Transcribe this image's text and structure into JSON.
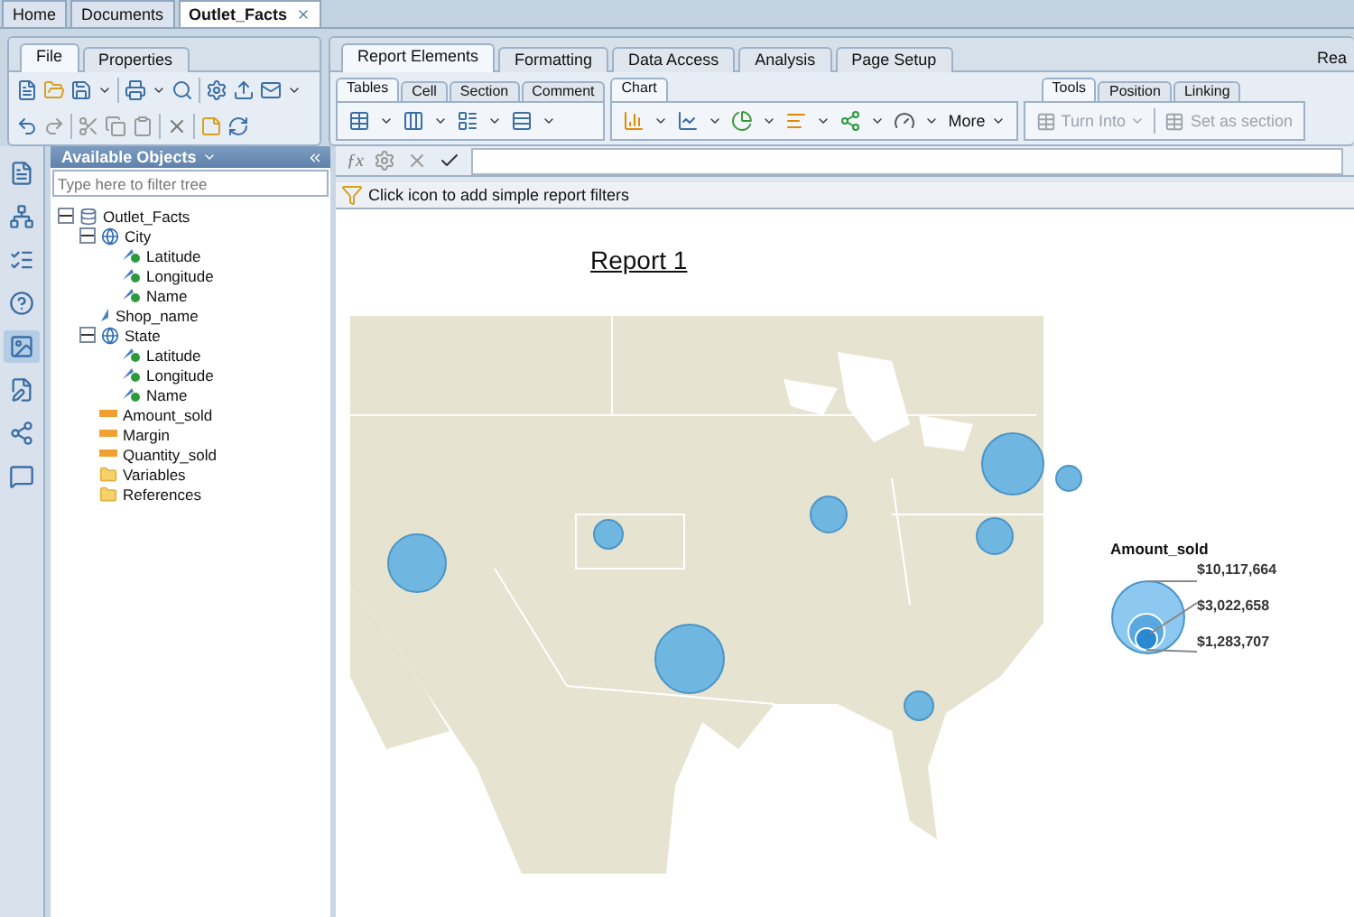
{
  "top_tabs": [
    {
      "label": "Home",
      "selected": false
    },
    {
      "label": "Documents",
      "selected": false
    },
    {
      "label": "Outlet_Facts",
      "selected": true
    }
  ],
  "left_ribbon": {
    "tabs": [
      {
        "label": "File",
        "selected": true
      },
      {
        "label": "Properties",
        "selected": false
      }
    ]
  },
  "main_ribbon": {
    "tabs": [
      {
        "label": "Report Elements",
        "selected": true
      },
      {
        "label": "Formatting",
        "selected": false
      },
      {
        "label": "Data Access",
        "selected": false
      },
      {
        "label": "Analysis",
        "selected": false
      },
      {
        "label": "Page Setup",
        "selected": false
      }
    ],
    "cut_label": "Rea",
    "table_tabs": [
      {
        "label": "Tables",
        "selected": true
      },
      {
        "label": "Cell",
        "selected": false
      },
      {
        "label": "Section",
        "selected": false
      },
      {
        "label": "Comment",
        "selected": false
      }
    ],
    "chart_tabs": [
      {
        "label": "Chart",
        "selected": true
      }
    ],
    "more_button": "More",
    "tool_tabs": [
      {
        "label": "Tools",
        "selected": true
      },
      {
        "label": "Position",
        "selected": false
      },
      {
        "label": "Linking",
        "selected": false
      }
    ],
    "tool_buttons": [
      {
        "label": "Turn Into",
        "disabled": true,
        "dropdown": true
      },
      {
        "label": "Set as section",
        "disabled": true,
        "dropdown": false
      }
    ]
  },
  "side_panel": {
    "title": "Available Objects",
    "filter": {
      "placeholder": "Type here to filter tree"
    },
    "tree": [
      {
        "label": "Outlet_Facts",
        "kind": "universe",
        "expanded": true,
        "children": [
          {
            "label": "City",
            "kind": "geo",
            "expanded": true,
            "children": [
              {
                "label": "Latitude",
                "kind": "attribute"
              },
              {
                "label": "Longitude",
                "kind": "attribute"
              },
              {
                "label": "Name",
                "kind": "attribute"
              }
            ]
          },
          {
            "label": "Shop_name",
            "kind": "dimension"
          },
          {
            "label": "State",
            "kind": "geo",
            "expanded": true,
            "children": [
              {
                "label": "Latitude",
                "kind": "attribute"
              },
              {
                "label": "Longitude",
                "kind": "attribute"
              },
              {
                "label": "Name",
                "kind": "attribute"
              }
            ]
          },
          {
            "label": "Amount_sold",
            "kind": "measure"
          },
          {
            "label": "Margin",
            "kind": "measure"
          },
          {
            "label": "Quantity_sold",
            "kind": "measure"
          },
          {
            "label": "Variables",
            "kind": "folder"
          },
          {
            "label": "References",
            "kind": "folder"
          }
        ]
      }
    ]
  },
  "formula_bar": {
    "fx_label": "ƒx"
  },
  "filter_bar": {
    "text": "Click icon to add simple report filters"
  },
  "report": {
    "title": "Report 1",
    "legend": {
      "title": "Amount_sold",
      "entries": [
        "$10,117,664",
        "$3,022,658",
        "$1,283,707"
      ]
    }
  }
}
